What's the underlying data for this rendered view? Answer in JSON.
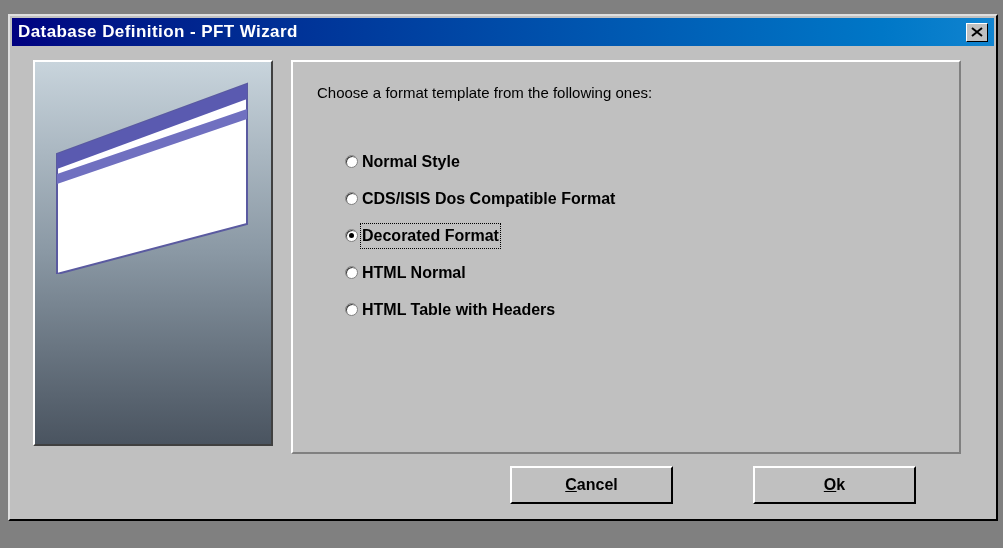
{
  "window": {
    "title": "Database Definition - PFT Wizard"
  },
  "prompt": "Choose a format template from the following ones:",
  "options": [
    {
      "label": "Normal Style",
      "selected": false
    },
    {
      "label": "CDS/ISIS Dos Compatible Format",
      "selected": false
    },
    {
      "label": "Decorated Format",
      "selected": true
    },
    {
      "label": "HTML Normal",
      "selected": false
    },
    {
      "label": "HTML Table with Headers",
      "selected": false
    }
  ],
  "buttons": [
    {
      "access_key": "C",
      "rest": "ancel"
    },
    {
      "access_key": "O",
      "rest": "k"
    }
  ]
}
